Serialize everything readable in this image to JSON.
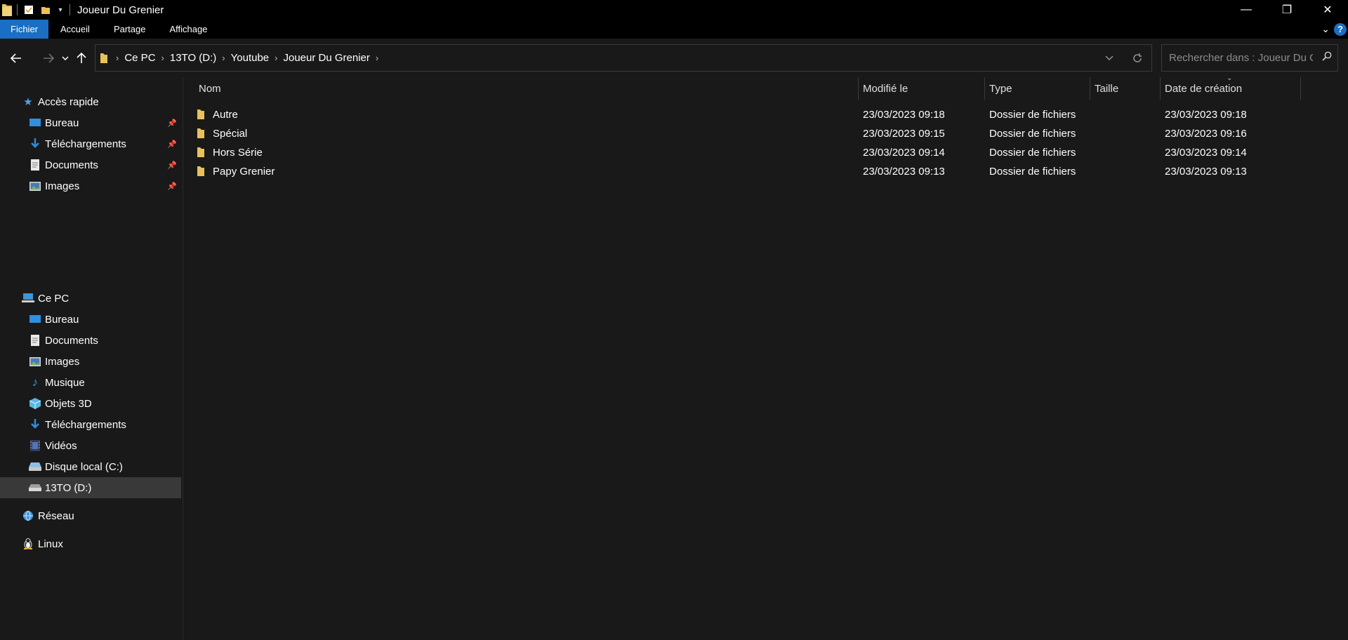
{
  "window": {
    "title": "Joueur Du Grenier",
    "controls": {
      "minimize": "—",
      "maximize": "❐",
      "close": "✕"
    }
  },
  "ribbon": {
    "tabs": [
      {
        "label": "Fichier",
        "active": true
      },
      {
        "label": "Accueil"
      },
      {
        "label": "Partage"
      },
      {
        "label": "Affichage"
      }
    ],
    "help_label": "?"
  },
  "address": {
    "breadcrumbs": [
      "Ce PC",
      "13TO (D:)",
      "Youtube",
      "Joueur Du Grenier"
    ],
    "search_placeholder": "Rechercher dans : Joueur Du G..."
  },
  "sidebar": {
    "quick_access": {
      "label": "Accès rapide"
    },
    "quick_items": [
      {
        "label": "Bureau",
        "icon": "desktop-icon",
        "pinned": true
      },
      {
        "label": "Téléchargements",
        "icon": "download-icon",
        "pinned": true
      },
      {
        "label": "Documents",
        "icon": "document-icon",
        "pinned": true
      },
      {
        "label": "Images",
        "icon": "image-icon",
        "pinned": true
      }
    ],
    "this_pc": {
      "label": "Ce PC"
    },
    "pc_items": [
      {
        "label": "Bureau",
        "icon": "desktop-icon"
      },
      {
        "label": "Documents",
        "icon": "document-icon"
      },
      {
        "label": "Images",
        "icon": "image-icon"
      },
      {
        "label": "Musique",
        "icon": "music-icon"
      },
      {
        "label": "Objets 3D",
        "icon": "3d-objects-icon"
      },
      {
        "label": "Téléchargements",
        "icon": "download-icon"
      },
      {
        "label": "Vidéos",
        "icon": "video-icon"
      },
      {
        "label": "Disque local (C:)",
        "icon": "drive-icon"
      },
      {
        "label": "13TO (D:)",
        "icon": "drive-icon",
        "selected": true
      }
    ],
    "network": {
      "label": "Réseau"
    },
    "linux": {
      "label": "Linux"
    }
  },
  "columns": {
    "name": "Nom",
    "modified": "Modifié le",
    "type": "Type",
    "size": "Taille",
    "created": "Date de création"
  },
  "files": [
    {
      "name": "Autre",
      "modified": "23/03/2023 09:18",
      "type": "Dossier de fichiers",
      "size": "",
      "created": "23/03/2023 09:18"
    },
    {
      "name": "Spécial",
      "modified": "23/03/2023 09:15",
      "type": "Dossier de fichiers",
      "size": "",
      "created": "23/03/2023 09:16"
    },
    {
      "name": "Hors Série",
      "modified": "23/03/2023 09:14",
      "type": "Dossier de fichiers",
      "size": "",
      "created": "23/03/2023 09:14"
    },
    {
      "name": "Papy Grenier",
      "modified": "23/03/2023 09:13",
      "type": "Dossier de fichiers",
      "size": "",
      "created": "23/03/2023 09:13"
    }
  ],
  "colors": {
    "accent": "#1a6fc4",
    "folder": "#e8c15a",
    "background": "#191919",
    "titlebar": "#000000",
    "selected": "#393939"
  }
}
